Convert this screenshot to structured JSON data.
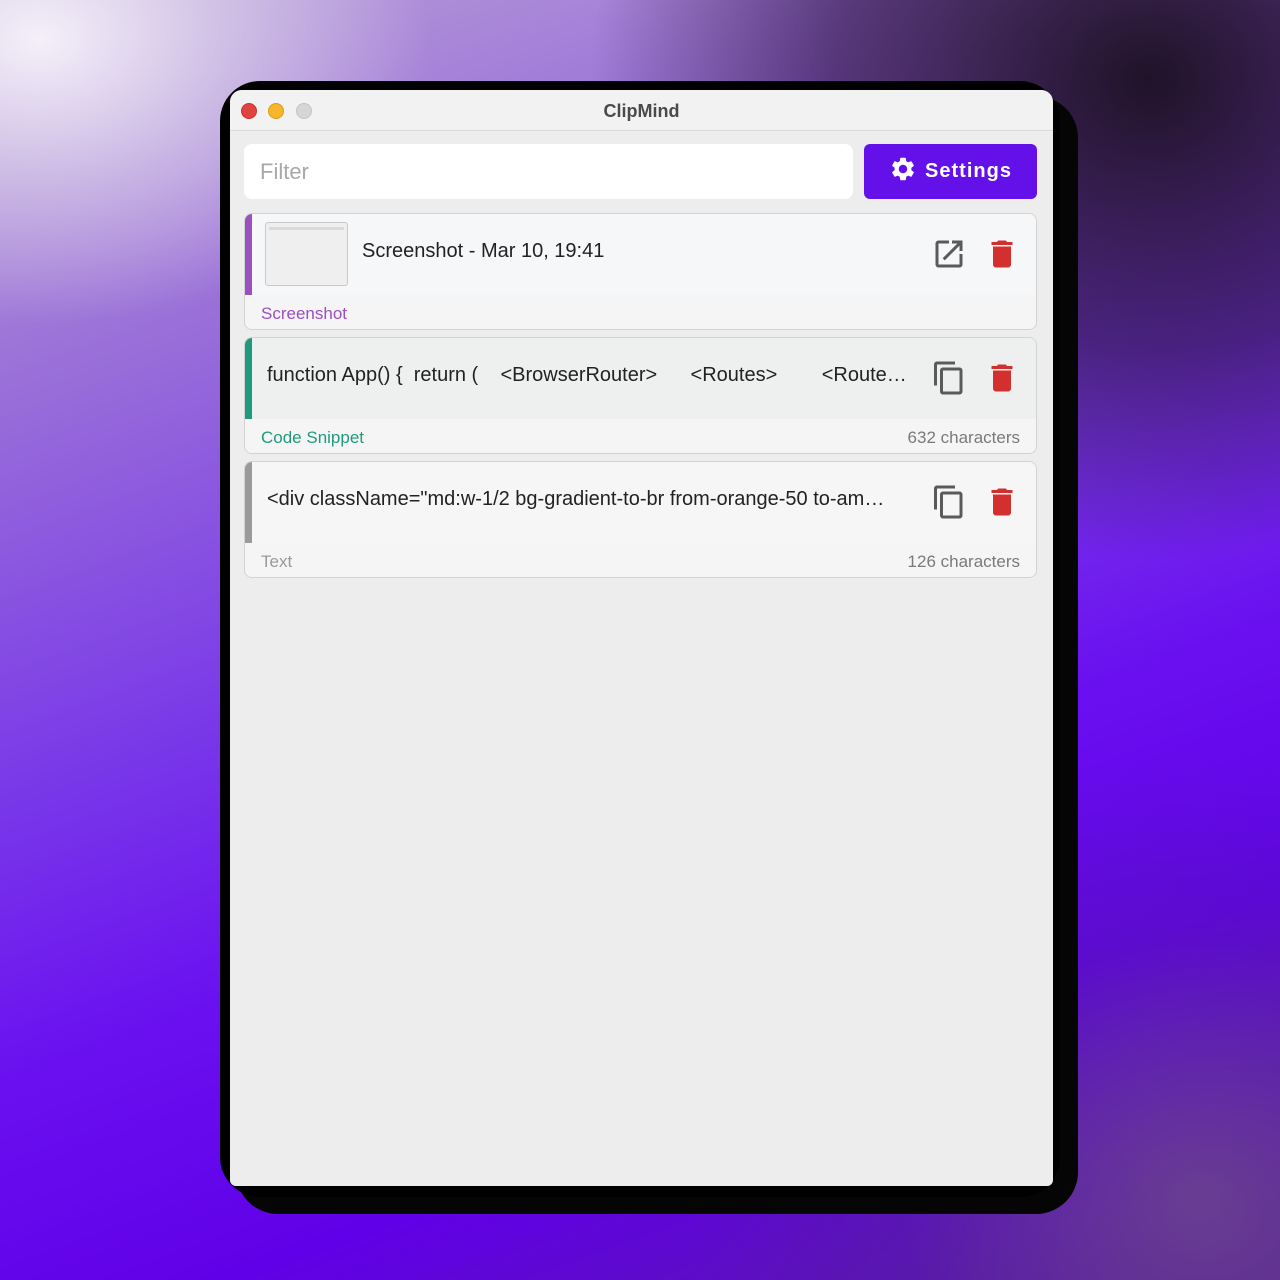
{
  "app": {
    "title": "ClipMind"
  },
  "toolbar": {
    "filter_placeholder": "Filter",
    "settings_label": "Settings"
  },
  "colors": {
    "accent": "#6311e8",
    "screenshot": "#9b4fc0",
    "code": "#1f9a7c",
    "text": "#9a9a9a",
    "delete": "#d32f2f"
  },
  "items": [
    {
      "kind": "Screenshot",
      "title": "Screenshot - Mar 10, 19:41",
      "count": "",
      "action_icon": "open-external-icon"
    },
    {
      "kind": "Code Snippet",
      "title": "function App() {  return (    <BrowserRouter>      <Routes>        <Route…",
      "count": "632 characters",
      "action_icon": "copy-icon"
    },
    {
      "kind": "Text",
      "title": "<div className=\"md:w-1/2 bg-gradient-to-br from-orange-50 to-am…",
      "count": "126 characters",
      "action_icon": "copy-icon"
    }
  ]
}
